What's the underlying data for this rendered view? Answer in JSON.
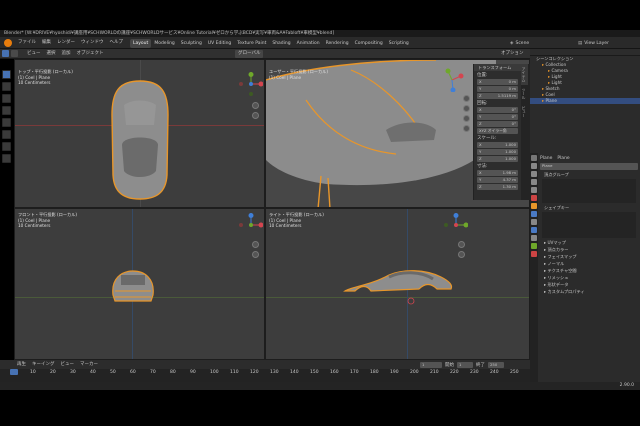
{
  "window_title": "Blender* [W:¥DRIVE¥hyoshidi¥講座用¥SCHWORLDの講座¥SCHWORLDサービス¥Online Tutorial¥ゼロから学ぶBCD¥実写¥車両&A¥Fabloft¥車模型¥blend]",
  "menu": {
    "items": [
      "ファイル",
      "編集",
      "レンダー",
      "ウィンドウ",
      "ヘルプ"
    ],
    "workspaces": [
      "Layout",
      "Modeling",
      "Sculpting",
      "UV Editing",
      "Texture Paint",
      "Shading",
      "Animation",
      "Rendering",
      "Compositing",
      "Scripting"
    ],
    "active_workspace": "Layout",
    "scene_label": "Scene",
    "view_layer_label": "View Layer"
  },
  "header": {
    "view_menus": [
      "ビュー",
      "選択",
      "追加",
      "オブジェクト"
    ],
    "mode": "グローバル",
    "options": "オプション"
  },
  "viewports": {
    "top": {
      "title": "トップ・平行投影 (ローカル)",
      "object": "(1) Coel | Plane",
      "scale": "10 Centimeters"
    },
    "user": {
      "title": "ユーザー・平行投影 (ローカル)",
      "object": "(1) Coel | Plane"
    },
    "front": {
      "title": "フロント・平行投影 (ローカル)",
      "object": "(1) Coel | Plane",
      "scale": "10 Centimeters"
    },
    "right": {
      "title": "ライト・平行投影 (ローカル)",
      "object": "(1) Coel | Plane",
      "scale": "10 Centimeters"
    }
  },
  "npanel": {
    "section": "トランスフォーム",
    "location_label": "位置:",
    "location": [
      {
        "axis": "X",
        "value": "0 m"
      },
      {
        "axis": "Y",
        "value": "0 m"
      },
      {
        "axis": "Z",
        "value": "1.5119 m"
      }
    ],
    "rotation_label": "回転:",
    "rotation": [
      {
        "axis": "X",
        "value": "0°"
      },
      {
        "axis": "Y",
        "value": "0°"
      },
      {
        "axis": "Z",
        "value": "0°"
      }
    ],
    "rotation_mode": "XYZ オイラー角",
    "scale_label": "スケール:",
    "scale": [
      {
        "axis": "X",
        "value": "1.000"
      },
      {
        "axis": "Y",
        "value": "1.000"
      },
      {
        "axis": "Z",
        "value": "1.000"
      }
    ],
    "dimensions_label": "寸法:",
    "dimensions": [
      {
        "axis": "X",
        "value": "1.98 m"
      },
      {
        "axis": "Y",
        "value": "4.37 m"
      },
      {
        "axis": "Z",
        "value": "1.30 m"
      }
    ],
    "tabs": [
      "アイテム",
      "ツール",
      "ビュー"
    ]
  },
  "outliner": {
    "header": "シーンコレクション",
    "items": [
      {
        "label": "Collection",
        "level": 1,
        "selected": false
      },
      {
        "label": "Camera",
        "level": 2,
        "selected": false
      },
      {
        "label": "Light",
        "level": 2,
        "selected": false
      },
      {
        "label": "Light",
        "level": 2,
        "selected": false
      },
      {
        "label": "Sketch",
        "level": 1,
        "selected": false
      },
      {
        "label": "Coel",
        "level": 1,
        "selected": false
      },
      {
        "label": "Plane",
        "level": 1,
        "selected": true
      }
    ]
  },
  "properties": {
    "object_name": "Plane",
    "mesh_name": "Plane",
    "field_value": "Plane",
    "sections": [
      "頂点グループ",
      "シェイプキー",
      "UVマップ",
      "頂点カラー",
      "フェイスマップ",
      "ノーマル",
      "テクスチャ空間",
      "リメッシュ",
      "形状データ",
      "カスタムプロパティ"
    ]
  },
  "timeline": {
    "menus": [
      "再生",
      "キーイング",
      "ビュー",
      "マーカー"
    ],
    "current_frame": "1",
    "start_label": "開始",
    "start": "1",
    "end_label": "終了",
    "end": "250",
    "ticks": [
      "0",
      "10",
      "20",
      "30",
      "40",
      "50",
      "60",
      "70",
      "80",
      "90",
      "100",
      "110",
      "120",
      "130",
      "140",
      "150",
      "160",
      "170",
      "180",
      "190",
      "200",
      "210",
      "220",
      "230",
      "240",
      "250"
    ]
  },
  "status": {
    "version": "2.90.0"
  },
  "colors": {
    "accent": "#e87d0d",
    "selection": "#4772b3",
    "axis_x": "#d4454f",
    "axis_y": "#6fa82a",
    "axis_z": "#3f7fd8"
  }
}
